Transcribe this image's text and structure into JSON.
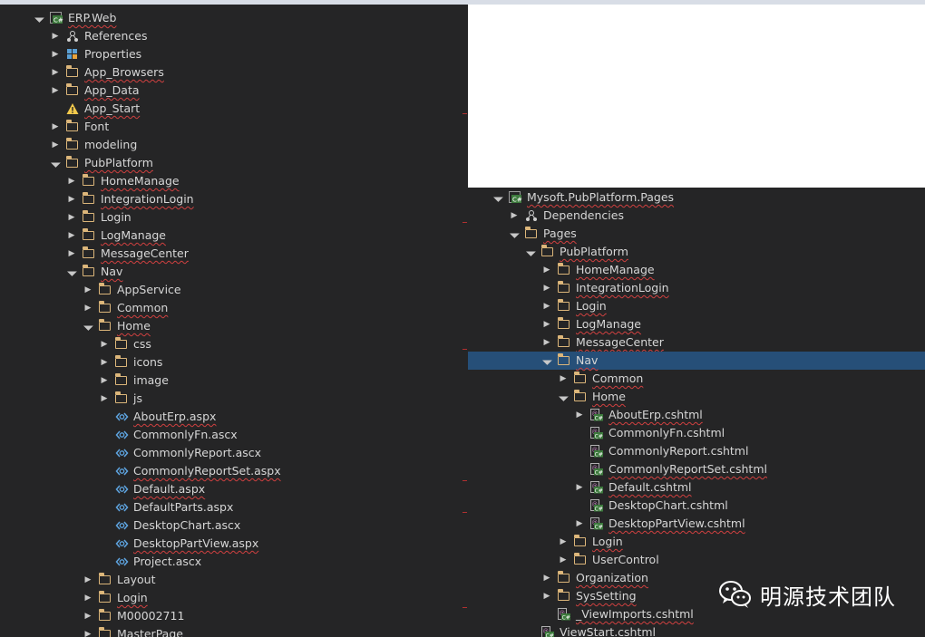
{
  "left_tree": [
    {
      "depth": 0,
      "label": "ERP.Web",
      "icon": "csharp-project-icon",
      "exp": "open",
      "squig": true
    },
    {
      "depth": 1,
      "label": "References",
      "icon": "references-icon",
      "exp": "closed"
    },
    {
      "depth": 1,
      "label": "Properties",
      "icon": "properties-icon",
      "exp": "closed"
    },
    {
      "depth": 1,
      "label": "App_Browsers",
      "icon": "folder-icon",
      "exp": "closed",
      "squig": true
    },
    {
      "depth": 1,
      "label": "App_Data",
      "icon": "folder-icon",
      "exp": "closed",
      "squig": true
    },
    {
      "depth": 1,
      "label": "App_Start",
      "icon": "warning-icon",
      "exp": "none",
      "squig": true
    },
    {
      "depth": 1,
      "label": "Font",
      "icon": "folder-icon",
      "exp": "closed"
    },
    {
      "depth": 1,
      "label": "modeling",
      "icon": "folder-icon",
      "exp": "closed"
    },
    {
      "depth": 1,
      "label": "PubPlatform",
      "icon": "folder-icon",
      "exp": "open",
      "squig": true
    },
    {
      "depth": 2,
      "label": "HomeManage",
      "icon": "folder-icon",
      "exp": "closed",
      "squig": true
    },
    {
      "depth": 2,
      "label": "IntegrationLogin",
      "icon": "folder-icon",
      "exp": "closed",
      "squig": true
    },
    {
      "depth": 2,
      "label": "Login",
      "icon": "folder-icon",
      "exp": "closed"
    },
    {
      "depth": 2,
      "label": "LogManage",
      "icon": "folder-icon",
      "exp": "closed",
      "squig": true
    },
    {
      "depth": 2,
      "label": "MessageCenter",
      "icon": "folder-icon",
      "exp": "closed",
      "squig": true
    },
    {
      "depth": 2,
      "label": "Nav",
      "icon": "folder-icon",
      "exp": "open",
      "squig": true
    },
    {
      "depth": 3,
      "label": "AppService",
      "icon": "folder-icon",
      "exp": "closed"
    },
    {
      "depth": 3,
      "label": "Common",
      "icon": "folder-icon",
      "exp": "closed",
      "squig": true
    },
    {
      "depth": 3,
      "label": "Home",
      "icon": "folder-icon",
      "exp": "open",
      "squig": true
    },
    {
      "depth": 4,
      "label": "css",
      "icon": "folder-icon",
      "exp": "closed"
    },
    {
      "depth": 4,
      "label": "icons",
      "icon": "folder-icon",
      "exp": "closed"
    },
    {
      "depth": 4,
      "label": "image",
      "icon": "folder-icon",
      "exp": "closed"
    },
    {
      "depth": 4,
      "label": "js",
      "icon": "folder-icon",
      "exp": "closed"
    },
    {
      "depth": 4,
      "label": "AboutErp.aspx",
      "icon": "aspx-file-icon",
      "exp": "none",
      "squig": true
    },
    {
      "depth": 4,
      "label": "CommonlyFn.ascx",
      "icon": "aspx-file-icon",
      "exp": "none"
    },
    {
      "depth": 4,
      "label": "CommonlyReport.ascx",
      "icon": "aspx-file-icon",
      "exp": "none"
    },
    {
      "depth": 4,
      "label": "CommonlyReportSet.aspx",
      "icon": "aspx-file-icon",
      "exp": "none",
      "squig": true
    },
    {
      "depth": 4,
      "label": "Default.aspx",
      "icon": "aspx-file-icon",
      "exp": "none",
      "squig": true
    },
    {
      "depth": 4,
      "label": "DefaultParts.aspx",
      "icon": "aspx-file-icon",
      "exp": "none"
    },
    {
      "depth": 4,
      "label": "DesktopChart.ascx",
      "icon": "aspx-file-icon",
      "exp": "none"
    },
    {
      "depth": 4,
      "label": "DesktopPartView.aspx",
      "icon": "aspx-file-icon",
      "exp": "none",
      "squig": true
    },
    {
      "depth": 4,
      "label": "Project.ascx",
      "icon": "aspx-file-icon",
      "exp": "none"
    },
    {
      "depth": 3,
      "label": "Layout",
      "icon": "folder-icon",
      "exp": "closed"
    },
    {
      "depth": 3,
      "label": "Login",
      "icon": "folder-icon",
      "exp": "closed",
      "squig": true
    },
    {
      "depth": 3,
      "label": "M00002711",
      "icon": "folder-icon",
      "exp": "closed"
    },
    {
      "depth": 3,
      "label": "MasterPage",
      "icon": "folder-icon",
      "exp": "closed"
    }
  ],
  "right_tree": [
    {
      "depth": 0,
      "label": "Mysoft.PubPlatform.Pages",
      "icon": "csharp-project-icon",
      "exp": "open",
      "squig": true
    },
    {
      "depth": 1,
      "label": "Dependencies",
      "icon": "dependencies-icon",
      "exp": "closed"
    },
    {
      "depth": 1,
      "label": "Pages",
      "icon": "folder-icon",
      "exp": "open",
      "squig": true
    },
    {
      "depth": 2,
      "label": "PubPlatform",
      "icon": "folder-icon",
      "exp": "open",
      "squig": true
    },
    {
      "depth": 3,
      "label": "HomeManage",
      "icon": "folder-icon",
      "exp": "closed",
      "squig": true
    },
    {
      "depth": 3,
      "label": "IntegrationLogin",
      "icon": "folder-icon",
      "exp": "closed",
      "squig": true
    },
    {
      "depth": 3,
      "label": "Login",
      "icon": "folder-icon",
      "exp": "closed",
      "squig": true
    },
    {
      "depth": 3,
      "label": "LogManage",
      "icon": "folder-icon",
      "exp": "closed",
      "squig": true
    },
    {
      "depth": 3,
      "label": "MessageCenter",
      "icon": "folder-icon",
      "exp": "closed",
      "squig": true
    },
    {
      "depth": 3,
      "label": "Nav",
      "icon": "folder-icon",
      "exp": "open",
      "squig": true,
      "selected": true
    },
    {
      "depth": 4,
      "label": "Common",
      "icon": "folder-icon",
      "exp": "closed",
      "squig": true
    },
    {
      "depth": 4,
      "label": "Home",
      "icon": "folder-icon",
      "exp": "open",
      "squig": true
    },
    {
      "depth": 5,
      "label": "AboutErp.cshtml",
      "icon": "cshtml-file-icon",
      "exp": "closed",
      "squig": true
    },
    {
      "depth": 5,
      "label": "CommonlyFn.cshtml",
      "icon": "cshtml-file-icon",
      "exp": "none"
    },
    {
      "depth": 5,
      "label": "CommonlyReport.cshtml",
      "icon": "cshtml-file-icon",
      "exp": "none"
    },
    {
      "depth": 5,
      "label": "CommonlyReportSet.cshtml",
      "icon": "cshtml-file-icon",
      "exp": "none",
      "squig": true
    },
    {
      "depth": 5,
      "label": "Default.cshtml",
      "icon": "cshtml-file-icon",
      "exp": "closed",
      "squig": true
    },
    {
      "depth": 5,
      "label": "DesktopChart.cshtml",
      "icon": "cshtml-file-icon",
      "exp": "none"
    },
    {
      "depth": 5,
      "label": "DesktopPartView.cshtml",
      "icon": "cshtml-file-icon",
      "exp": "closed",
      "squig": true
    },
    {
      "depth": 4,
      "label": "Login",
      "icon": "folder-icon",
      "exp": "closed",
      "squig": true
    },
    {
      "depth": 4,
      "label": "UserControl",
      "icon": "folder-icon",
      "exp": "closed"
    },
    {
      "depth": 3,
      "label": "Organization",
      "icon": "folder-icon",
      "exp": "closed",
      "squig": true
    },
    {
      "depth": 3,
      "label": "SysSetting",
      "icon": "folder-icon",
      "exp": "closed",
      "squig": true
    },
    {
      "depth": 3,
      "label": "_ViewImports.cshtml",
      "icon": "cshtml-file-icon",
      "exp": "none",
      "squig": true
    },
    {
      "depth": 2,
      "label": "ViewStart.cshtml",
      "icon": "cshtml-file-icon",
      "exp": "none",
      "squig": true
    }
  ],
  "brand": {
    "text": "明源技术团队",
    "icon": "wechat-icon"
  },
  "colors": {
    "pane_bg": "#252526",
    "text": "#d6d6d6",
    "folder": "#dcb67a",
    "selection": "#264f78",
    "squiggle": "#d04040"
  }
}
